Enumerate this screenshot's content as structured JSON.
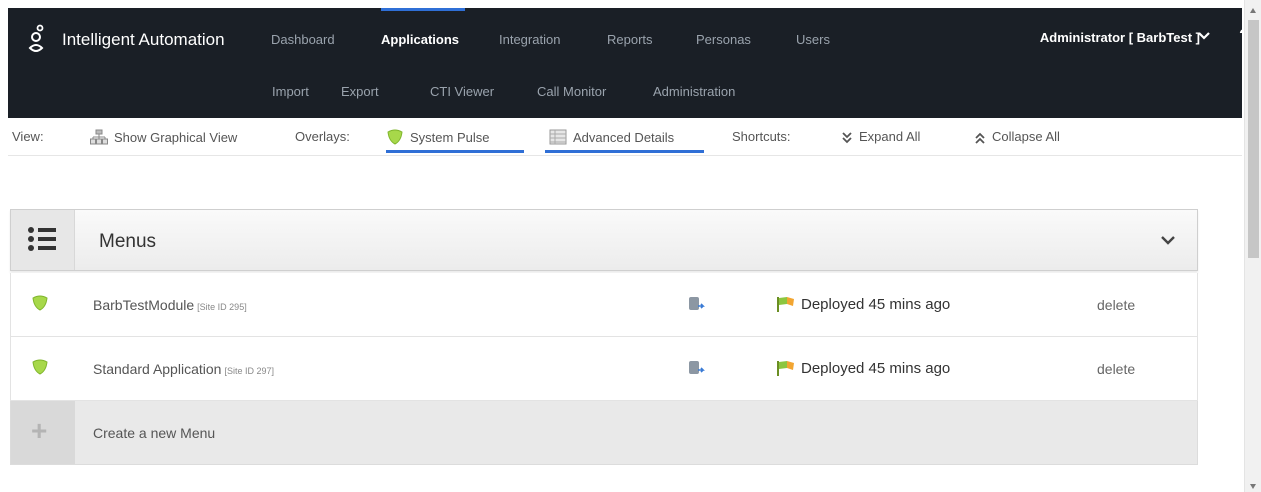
{
  "header": {
    "logo_icon": "drop-logo-icon",
    "app_title": "Intelligent Automation",
    "nav_primary": [
      {
        "label": "Dashboard",
        "active": false
      },
      {
        "label": "Applications",
        "active": true
      },
      {
        "label": "Integration",
        "active": false
      },
      {
        "label": "Reports",
        "active": false
      },
      {
        "label": "Personas",
        "active": false
      },
      {
        "label": "Users",
        "active": false
      }
    ],
    "nav_secondary": [
      {
        "label": "Import"
      },
      {
        "label": "Export"
      },
      {
        "label": "CTI Viewer"
      },
      {
        "label": "Call Monitor"
      },
      {
        "label": "Administration"
      }
    ],
    "user_label": "Administrator [ BarbTest ]",
    "help_label": "?",
    "accent_color": "#2f6fd6"
  },
  "toolbar": {
    "view_label": "View:",
    "graphical_view_label": "Show Graphical View",
    "overlays_label": "Overlays:",
    "system_pulse_label": "System Pulse",
    "advanced_details_label": "Advanced Details",
    "shortcuts_label": "Shortcuts:",
    "expand_all_label": "Expand All",
    "collapse_all_label": "Collapse All"
  },
  "menus": {
    "title": "Menus",
    "items": [
      {
        "name": "BarbTestModule",
        "site": "[Site ID 295]",
        "status": "Deployed 45 mins ago",
        "action": "delete"
      },
      {
        "name": "Standard Application",
        "site": "[Site ID 297]",
        "status": "Deployed 45 mins ago",
        "action": "delete"
      }
    ],
    "create_label": "Create a new Menu"
  }
}
